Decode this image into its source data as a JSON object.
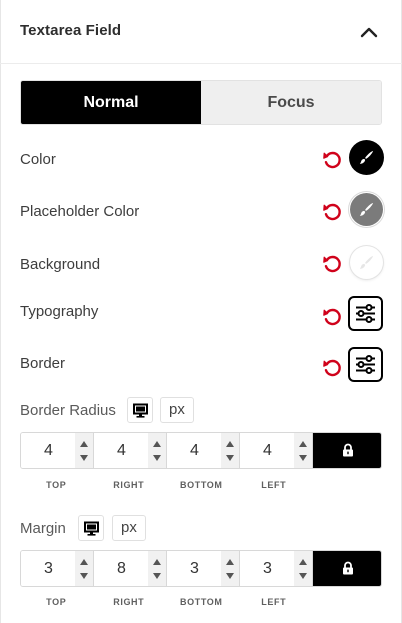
{
  "header": {
    "title": "Textarea Field",
    "toggle_icon": "chevron-up-icon"
  },
  "tabs": [
    {
      "label": "Normal",
      "active": true
    },
    {
      "label": "Focus",
      "active": false
    }
  ],
  "rows": {
    "color": {
      "label": "Color",
      "swatch": "#000000",
      "icon": "brush-icon"
    },
    "placeholder_color": {
      "label": "Placeholder Color",
      "swatch": "#7b7b7b",
      "icon": "brush-icon"
    },
    "background": {
      "label": "Background",
      "swatch": "#ffffff",
      "icon": "brush-icon"
    },
    "typography": {
      "label": "Typography",
      "icon": "sliders-icon"
    },
    "border": {
      "label": "Border",
      "icon": "sliders-icon"
    }
  },
  "reset_icon": "reset-icon",
  "reset_color": "#d0021b",
  "border_radius": {
    "label": "Border Radius",
    "device_icon": "desktop-icon",
    "unit": "px",
    "values": {
      "top": "4",
      "right": "4",
      "bottom": "4",
      "left": "4"
    },
    "linked": true
  },
  "margin": {
    "label": "Margin",
    "device_icon": "desktop-icon",
    "unit": "px",
    "values": {
      "top": "3",
      "right": "8",
      "bottom": "3",
      "left": "3"
    },
    "linked": true
  },
  "dimension_labels": {
    "top": "TOP",
    "right": "RIGHT",
    "bottom": "BOTTOM",
    "left": "LEFT"
  }
}
